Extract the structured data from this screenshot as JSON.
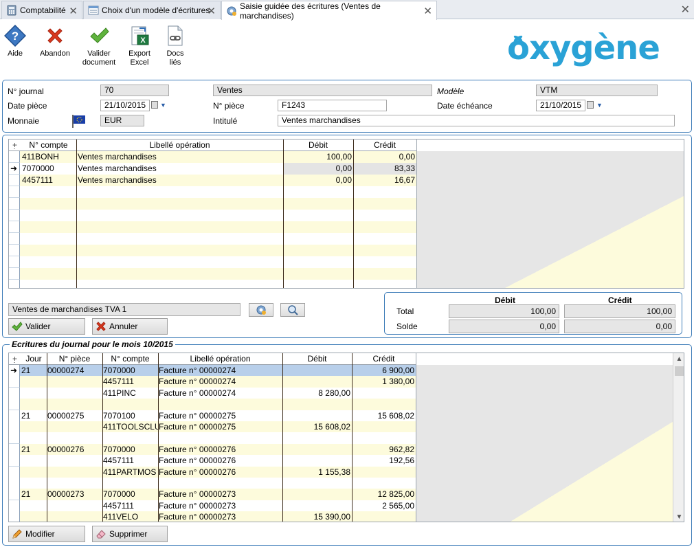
{
  "tabs": [
    {
      "label": "Comptabilité"
    },
    {
      "label": "Choix d'un modèle d'écritures"
    },
    {
      "label": "Saisie guidée des écritures (Ventes de marchandises)"
    }
  ],
  "toolbar": {
    "aide": "Aide",
    "abandon": "Abandon",
    "valider_l1": "Valider",
    "valider_l2": "document",
    "export_l1": "Export",
    "export_l2": "Excel",
    "docs_l1": "Docs",
    "docs_l2": "liés"
  },
  "brand": {
    "logo_text": "oxygène",
    "color": "#2aa2d6"
  },
  "header": {
    "journal_label": "N° journal",
    "journal_value": "70",
    "journal_name": "Ventes",
    "modele_label": "Modèle",
    "modele_value": "VTM",
    "date_piece_label": "Date pièce",
    "date_piece_value": "21/10/2015",
    "num_piece_label": "N° pièce",
    "num_piece_value": "F1243",
    "date_echeance_label": "Date échéance",
    "date_echeance_value": "21/10/2015",
    "monnaie_label": "Monnaie",
    "monnaie_value": "EUR",
    "intitule_label": "Intitulé",
    "intitule_value": "Ventes marchandises"
  },
  "entry_grid": {
    "columns": [
      "N° compte",
      "Libellé opération",
      "Débit",
      "Crédit"
    ],
    "rows": [
      {
        "compte": "411BONH",
        "libelle": "Ventes marchandises",
        "debit": "100,00",
        "credit": "0,00"
      },
      {
        "compte": "7070000",
        "libelle": "Ventes marchandises",
        "debit": "0,00",
        "credit": "83,33"
      },
      {
        "compte": "4457111",
        "libelle": "Ventes marchandises",
        "debit": "0,00",
        "credit": "16,67"
      }
    ]
  },
  "model_field": "Ventes de marchandises TVA 1",
  "buttons": {
    "valider": "Valider",
    "annuler": "Annuler",
    "modifier": "Modifier",
    "supprimer": "Supprimer"
  },
  "totals": {
    "debit_label": "Débit",
    "credit_label": "Crédit",
    "total_label": "Total",
    "solde_label": "Solde",
    "total_debit": "100,00",
    "total_credit": "100,00",
    "solde_debit": "0,00",
    "solde_credit": "0,00"
  },
  "journal": {
    "title": "Ecritures du journal pour le mois 10/2015",
    "columns": [
      "Jour",
      "N° pièce",
      "N° compte",
      "Libellé opération",
      "Débit",
      "Crédit"
    ],
    "rows": [
      {
        "jour": "21",
        "piece": "00000274",
        "compte": "7070000",
        "libelle": "Facture n° 00000274",
        "debit": "",
        "credit": "6 900,00"
      },
      {
        "jour": "",
        "piece": "",
        "compte": "4457111",
        "libelle": "Facture n° 00000274",
        "debit": "",
        "credit": "1 380,00"
      },
      {
        "jour": "",
        "piece": "",
        "compte": "411PINC",
        "libelle": "Facture n° 00000274",
        "debit": "8 280,00",
        "credit": ""
      },
      {
        "jour": "",
        "piece": "",
        "compte": "",
        "libelle": "",
        "debit": "",
        "credit": ""
      },
      {
        "jour": "21",
        "piece": "00000275",
        "compte": "7070100",
        "libelle": "Facture n° 00000275",
        "debit": "",
        "credit": "15 608,02"
      },
      {
        "jour": "",
        "piece": "",
        "compte": "411TOOLSCLU",
        "libelle": "Facture n° 00000275",
        "debit": "15 608,02",
        "credit": ""
      },
      {
        "jour": "",
        "piece": "",
        "compte": "",
        "libelle": "",
        "debit": "",
        "credit": ""
      },
      {
        "jour": "21",
        "piece": "00000276",
        "compte": "7070000",
        "libelle": "Facture n° 00000276",
        "debit": "",
        "credit": "962,82"
      },
      {
        "jour": "",
        "piece": "",
        "compte": "4457111",
        "libelle": "Facture n° 00000276",
        "debit": "",
        "credit": "192,56"
      },
      {
        "jour": "",
        "piece": "",
        "compte": "411PARTMOS",
        "libelle": "Facture n° 00000276",
        "debit": "1 155,38",
        "credit": ""
      },
      {
        "jour": "",
        "piece": "",
        "compte": "",
        "libelle": "",
        "debit": "",
        "credit": ""
      },
      {
        "jour": "21",
        "piece": "00000273",
        "compte": "7070000",
        "libelle": "Facture n° 00000273",
        "debit": "",
        "credit": "12 825,00"
      },
      {
        "jour": "",
        "piece": "",
        "compte": "4457111",
        "libelle": "Facture n° 00000273",
        "debit": "",
        "credit": "2 565,00"
      },
      {
        "jour": "",
        "piece": "",
        "compte": "411VELO",
        "libelle": "Facture n° 00000273",
        "debit": "15 390,00",
        "credit": ""
      }
    ]
  }
}
